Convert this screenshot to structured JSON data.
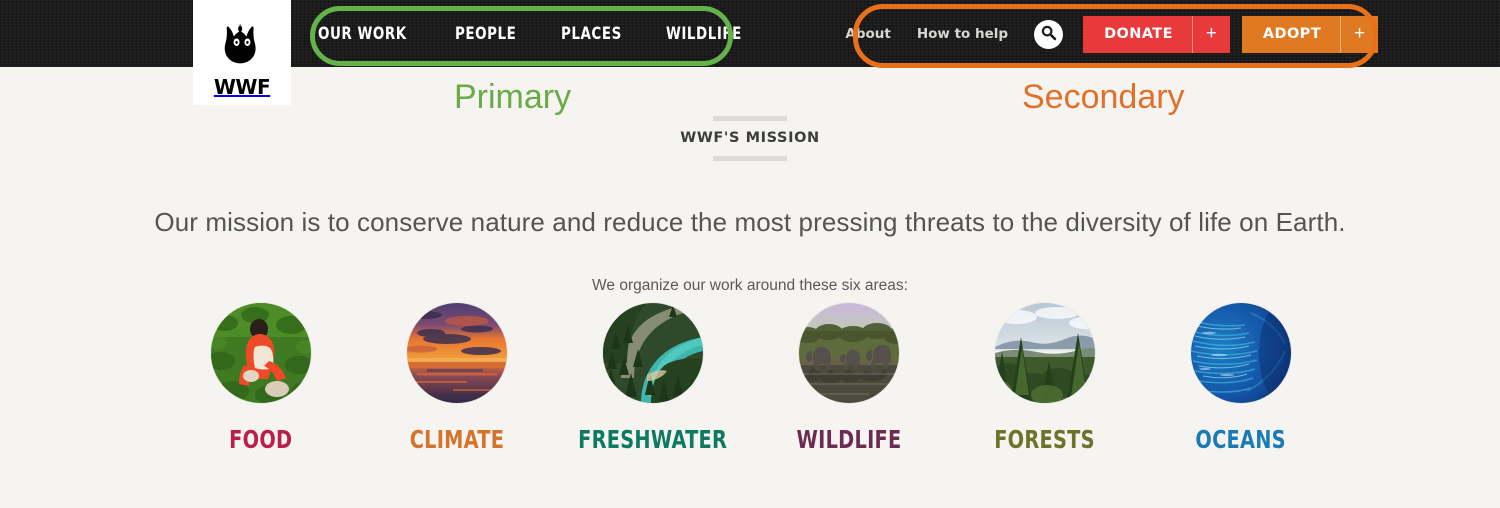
{
  "site": {
    "logo_text": "WWF",
    "logo_icon": "panda-logo"
  },
  "header": {
    "primary_nav": [
      {
        "label": "OUR WORK"
      },
      {
        "label": "PEOPLE"
      },
      {
        "label": "PLACES"
      },
      {
        "label": "WILDLIFE"
      }
    ],
    "secondary_nav": [
      {
        "label": "About"
      },
      {
        "label": "How to help"
      }
    ],
    "search_icon": "search-icon",
    "cta_buttons": [
      {
        "label": "DONATE",
        "plus": "+",
        "color": "#e8393b"
      },
      {
        "label": "ADOPT",
        "plus": "+",
        "color": "#e07a22"
      }
    ]
  },
  "annotations": [
    {
      "label": "Primary",
      "color": "#6aaa49"
    },
    {
      "label": "Secondary",
      "color": "#e0702a"
    }
  ],
  "mission": {
    "kicker": "WWF'S MISSION",
    "statement": "Our mission is to conserve nature and reduce the most pressing threats to the diversity of life on Earth.",
    "areas_subtitle": "We organize our work around these six areas:"
  },
  "areas": [
    {
      "label": "FOOD",
      "color": "#ba1f4b",
      "image": "farmer-in-green-field-photo"
    },
    {
      "label": "CLIMATE",
      "color": "#d4742c",
      "image": "sunset-over-water-photo"
    },
    {
      "label": "FRESHWATER",
      "color": "#0e7a5f",
      "image": "turquoise-river-in-forest-photo"
    },
    {
      "label": "WILDLIFE",
      "color": "#6b2b52",
      "image": "elephants-at-waterhole-photo"
    },
    {
      "label": "FORESTS",
      "color": "#6d7229",
      "image": "conifer-forest-vista-photo"
    },
    {
      "label": "OCEANS",
      "color": "#1b7bb5",
      "image": "school-of-fish-underwater-photo"
    }
  ]
}
